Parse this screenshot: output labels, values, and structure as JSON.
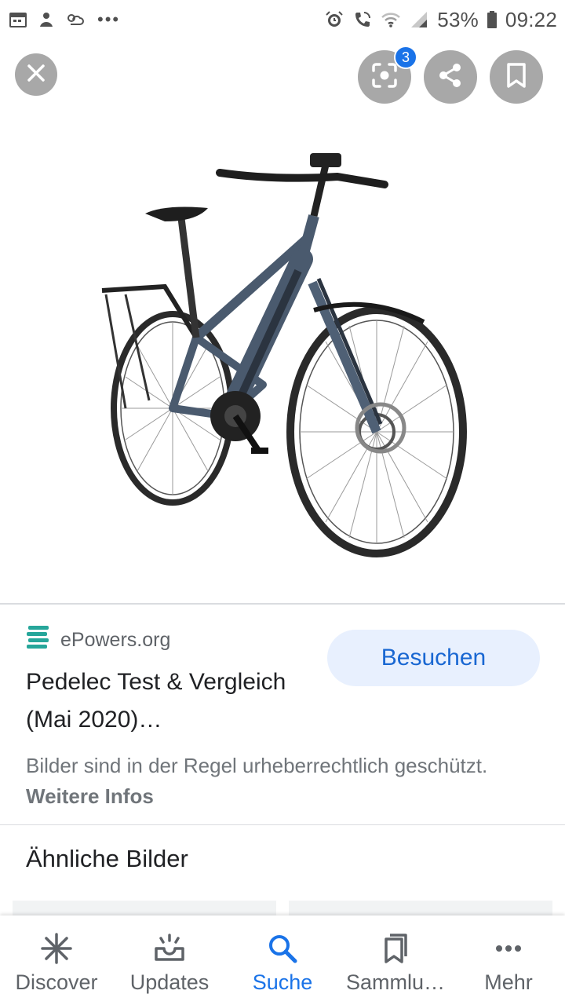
{
  "status_bar": {
    "battery": "53%",
    "time": "09:22",
    "left_icons": [
      "calendar-icon",
      "notification-icon",
      "weather-icon"
    ],
    "right_icons": [
      "alarm-icon",
      "wifi-call-icon",
      "wifi-icon",
      "signal-icon",
      "battery-icon"
    ]
  },
  "top_actions": {
    "lens_badge": "3",
    "icons": [
      "close-icon",
      "lens-icon",
      "share-icon",
      "bookmark-icon"
    ]
  },
  "result": {
    "source": "ePowers.org",
    "visit_label": "Besuchen",
    "title": "Pedelec Test & Vergleich (Mai 2020)…",
    "copyright_text": "Bilder sind in der Regel urheberrechtlich geschützt.",
    "more_info_label": "Weitere Infos"
  },
  "similar": {
    "heading": "Ähnliche Bilder"
  },
  "bottom_nav": [
    {
      "label": "Discover",
      "icon": "asterisk-icon"
    },
    {
      "label": "Updates",
      "icon": "updates-icon"
    },
    {
      "label": "Suche",
      "icon": "search-icon"
    },
    {
      "label": "Sammlu…",
      "icon": "collections-icon"
    },
    {
      "label": "Mehr",
      "icon": "more-icon"
    }
  ],
  "colors": {
    "accent": "#1a73e8",
    "visit_bg": "#e8f0fe",
    "overlay_button": "#a8a8a8",
    "bike_frame": "#4a5a6e"
  }
}
